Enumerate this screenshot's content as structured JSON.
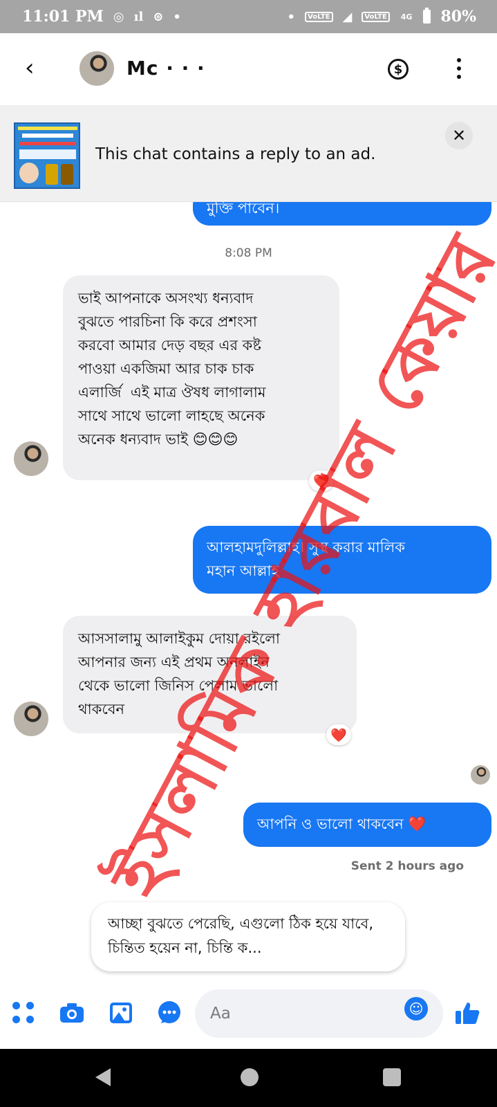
{
  "status_bar": {
    "time": "11:01 PM",
    "network_labels": [
      "VoLTE",
      "VoLTE",
      "4G"
    ],
    "battery": "80%"
  },
  "header": {
    "contact_name": "Mc ·  ·  ·"
  },
  "ad_banner": {
    "text": "This chat contains a reply to an ad."
  },
  "chat": {
    "top_partial_message": "মুক্তি পাবেন।",
    "timestamp": "8:08 PM",
    "messages": [
      {
        "text": "ভাই আপনাকে অসংখ্য ধন্যবাদ\nবুঝতে পারচিনা কি করে প্রশংসা\nকরবো আমার দেড় বছর এর কষ্ট\nপাওয়া একজিমা আর চাক চাক\nএলার্জি  এই মাত্র ঔষধ লাগালাম\nসাথে সাথে ভালো লাহছে অনেক\nঅনেক ধন্যবাদ ভাই 😊😊😊",
        "reaction": "❤️"
      },
      {
        "text": "আলহামদুলিল্লাহ। সুস্থ করার মালিক\nমহান আল্লাহ"
      },
      {
        "text": "আসসালামু আলাইকুম দোয়া রইলো\nআপনার জন্য এই প্রথম অনলাইন\nথেকে ভালো জিনিস পেলাম ভালো\nথাকবেন",
        "reaction": "❤️"
      },
      {
        "text": "আপনি ও ভালো থাকবেন ❤️"
      }
    ],
    "sent_status": "Sent 2 hours ago"
  },
  "watermark": {
    "text": "ইসলামিক হারবাল কেয়ার"
  },
  "suggested_reply": {
    "text": "আচ্ছা বুঝতে পেরেছি, এগুলো ঠিক হয়ে যাবে, চিন্তিত হয়েন না, চিন্তি ক..."
  },
  "composer": {
    "placeholder": "Aa"
  },
  "colors": {
    "accent": "#1877f2",
    "incoming_bubble": "#efeff1",
    "watermark": "#eb1414",
    "status_bar": "#a5a5a5"
  },
  "icons": [
    "back-icon",
    "dollar-icon",
    "more-icon",
    "close-icon",
    "apps-icon",
    "camera-icon",
    "gallery-icon",
    "chat-icon",
    "emoji-icon",
    "like-icon"
  ]
}
